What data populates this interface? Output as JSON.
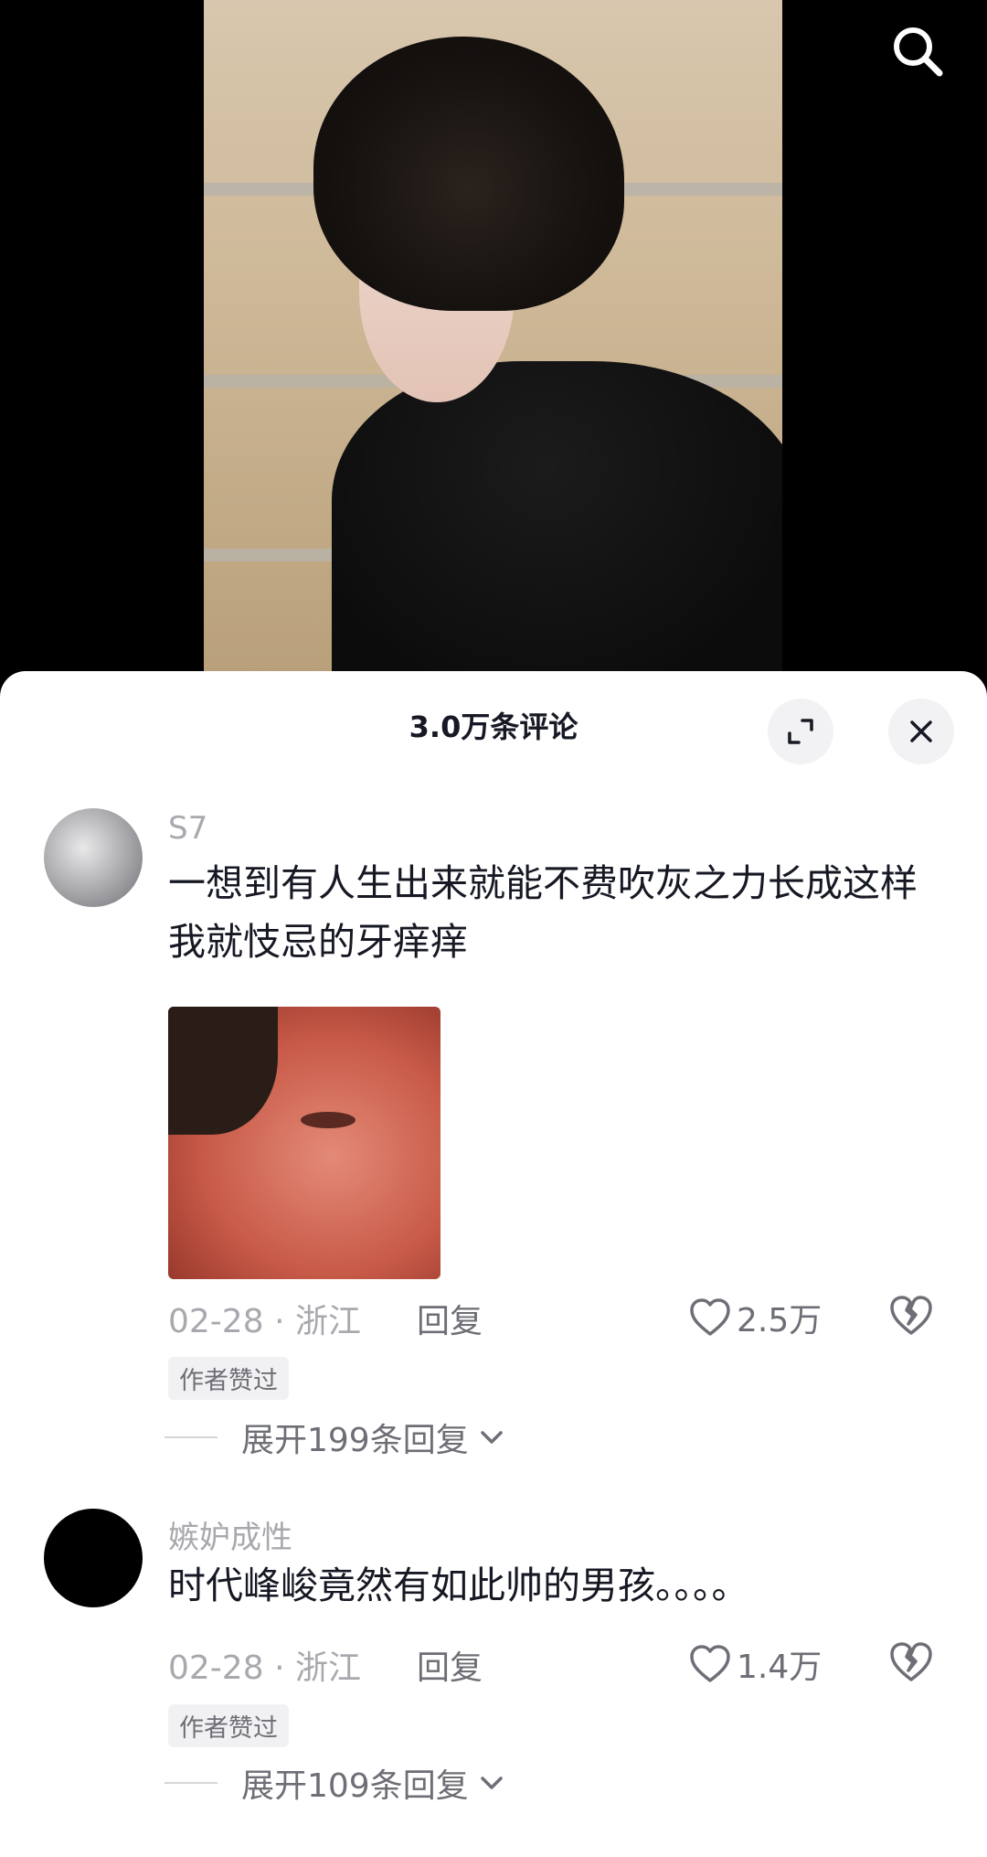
{
  "header": {
    "search_icon": "search-icon"
  },
  "sheet": {
    "title": "3.0万条评论",
    "expand_icon": "expand-icon",
    "close_icon": "close-icon"
  },
  "comments": [
    {
      "username": "S7",
      "text": "一想到有人生出来就能不费吹灰之力长成这样我就忮忌的牙痒痒",
      "has_image": true,
      "date": "02-28",
      "location": "浙江",
      "reply_label": "回复",
      "likes": "2.5万",
      "badge": "作者赞过",
      "expand_label": "展开199条回复"
    },
    {
      "username": "嫉妒成性",
      "text": "时代峰峻竟然有如此帅的男孩。。。。",
      "has_image": false,
      "date": "02-28",
      "location": "浙江",
      "reply_label": "回复",
      "likes": "1.4万",
      "badge": "作者赞过",
      "expand_label": "展开109条回复"
    }
  ],
  "meta_separator": "·",
  "colors": {
    "sheet_bg": "#ffffff",
    "primary_text": "#161823",
    "secondary_text": "#a8a9ae",
    "action_text": "#6e6f76"
  }
}
